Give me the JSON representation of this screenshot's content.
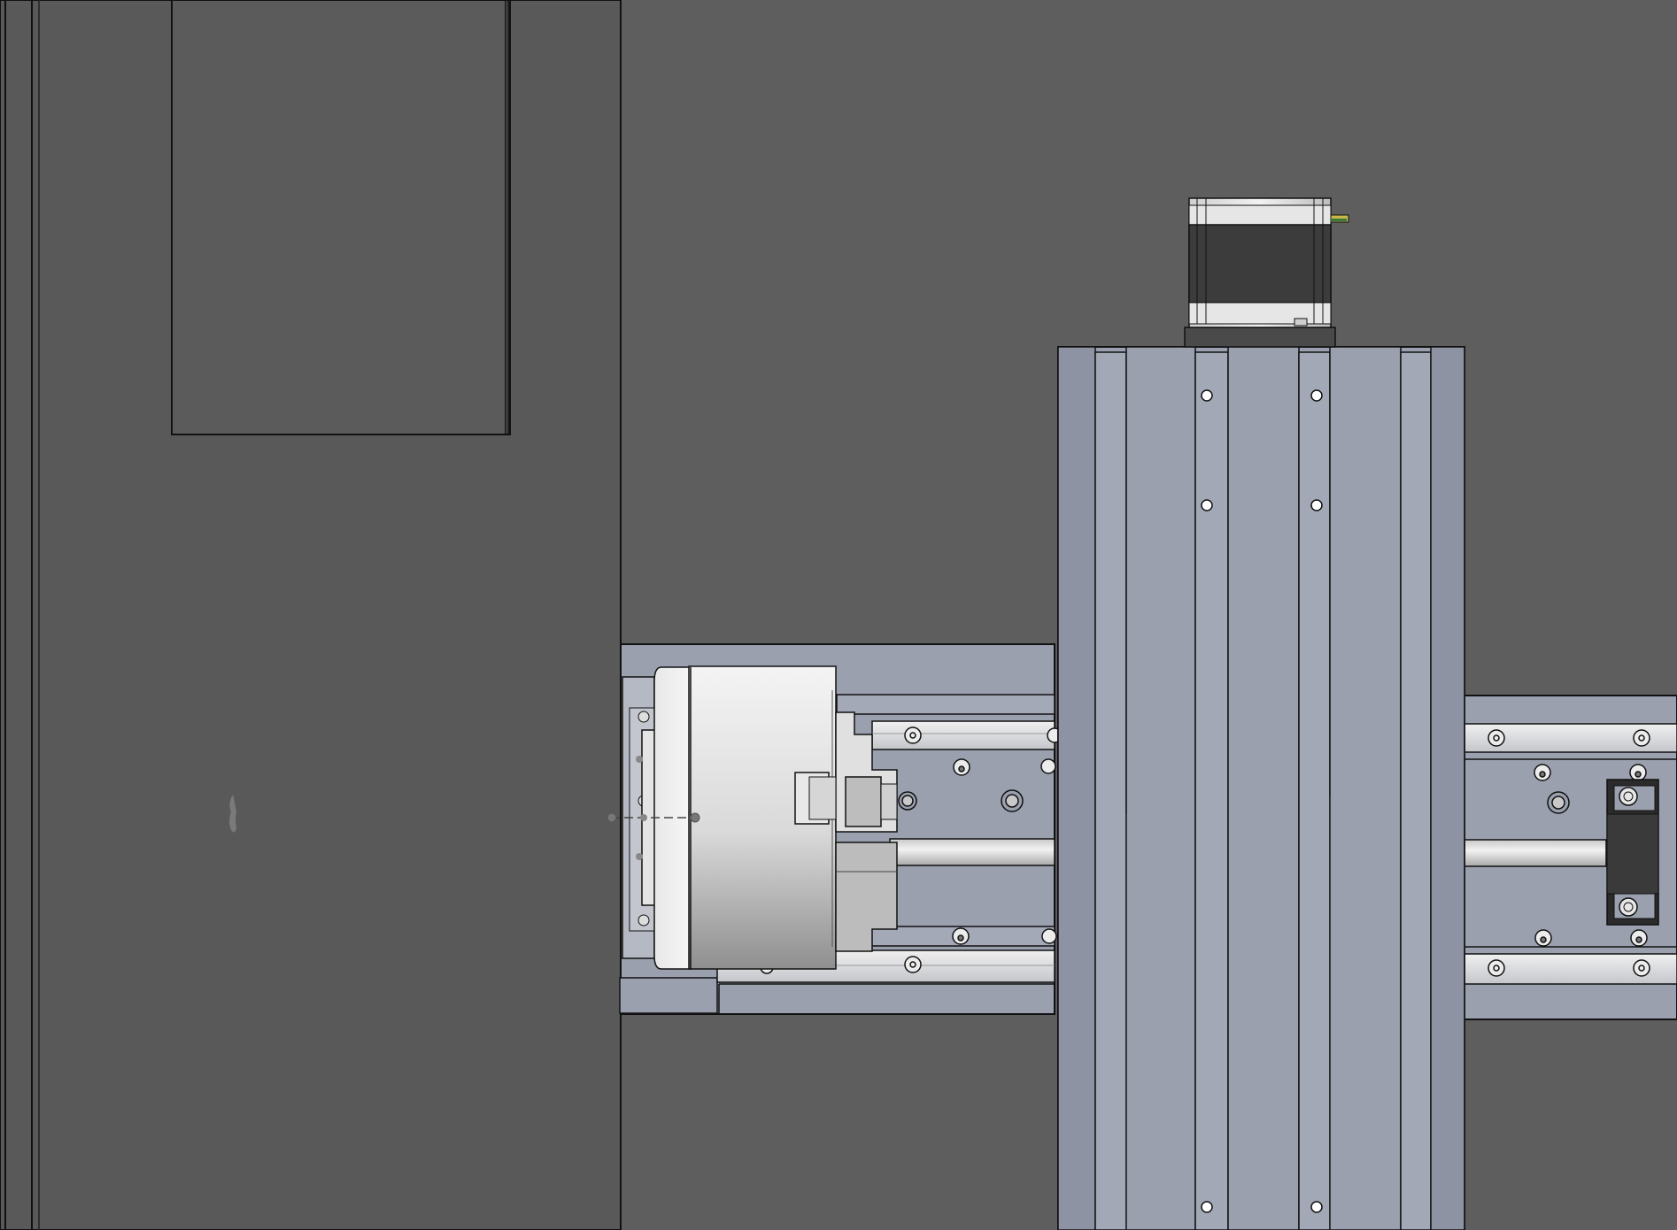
{
  "viewport": {
    "background": "#5e5e5e",
    "wall_color": "#595959",
    "panel_color": "#5b5b5b",
    "extrusion_color": "#9aa0ae",
    "extrusion_dark": "#8b90a0",
    "rail_color": "#d4d6da",
    "edge_color": "#111111"
  },
  "icons": {
    "motor": "stepper-motor-icon",
    "chuck": "lathe-chuck-icon",
    "bearing": "pillow-block-icon",
    "origin": "origin-marker-icon"
  }
}
